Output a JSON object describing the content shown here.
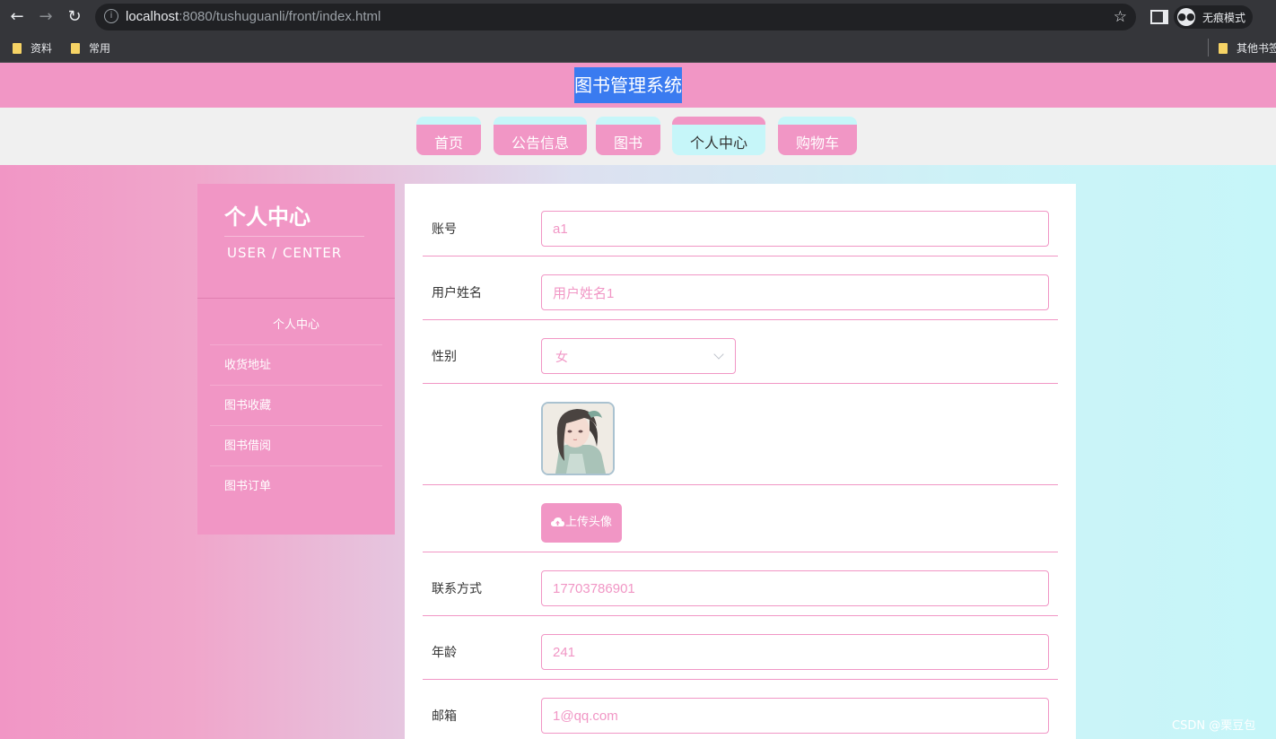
{
  "browser": {
    "url_host": "localhost",
    "url_path": ":8080/tushuguanli/front/index.html",
    "incognito_label": "无痕模式",
    "bookmarks": [
      "资料",
      "常用"
    ],
    "other_bookmarks": "其他书签"
  },
  "site": {
    "title": "图书管理系统"
  },
  "nav": {
    "items": [
      {
        "label": "首页",
        "active": false
      },
      {
        "label": "公告信息",
        "active": false
      },
      {
        "label": "图书",
        "active": false
      },
      {
        "label": "个人中心",
        "active": true
      },
      {
        "label": "购物车",
        "active": false
      }
    ]
  },
  "sidebar": {
    "title": "个人中心",
    "subtitle": "USER / CENTER",
    "items": [
      {
        "label": "个人中心"
      },
      {
        "label": "收货地址"
      },
      {
        "label": "图书收藏"
      },
      {
        "label": "图书借阅"
      },
      {
        "label": "图书订单"
      }
    ]
  },
  "form": {
    "account": {
      "label": "账号",
      "value": "a1"
    },
    "name": {
      "label": "用户姓名",
      "value": "用户姓名1"
    },
    "gender": {
      "label": "性别",
      "value": "女"
    },
    "upload_label": "上传头像",
    "phone": {
      "label": "联系方式",
      "value": "17703786901"
    },
    "age": {
      "label": "年龄",
      "value": "241"
    },
    "email": {
      "label": "邮箱",
      "value": "1@qq.com"
    }
  },
  "watermark": "CSDN @栗豆包",
  "colors": {
    "accent": "#f196c5",
    "secondary": "#c6f6f9",
    "title_highlight": "#3a7bf0"
  }
}
